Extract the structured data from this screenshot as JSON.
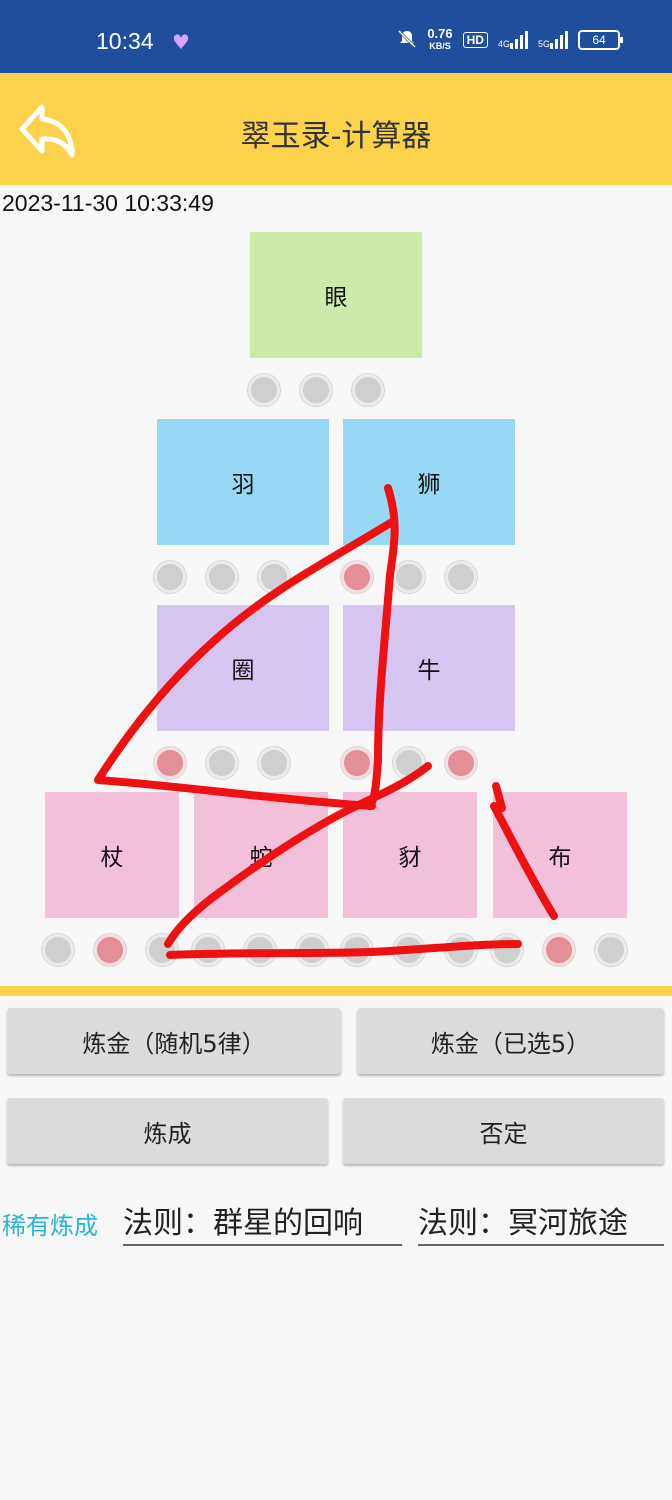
{
  "status": {
    "time": "10:34",
    "net_speed": "0.76",
    "net_unit": "KB/S",
    "hd": "HD",
    "signal1": "4G",
    "signal2": "5G",
    "battery": "64"
  },
  "appbar": {
    "title": "翠玉录-计算器",
    "back_icon": "back-arrow-icon"
  },
  "datetime": "2023-11-30 10:33:49",
  "tiles": {
    "top": "眼",
    "row2": [
      "羽",
      "狮"
    ],
    "row3": [
      "圈",
      "牛"
    ],
    "row4": [
      "杖",
      "蛇",
      "豺",
      "布"
    ]
  },
  "dots": {
    "row1": [
      false,
      false,
      false
    ],
    "row2": [
      false,
      false,
      false,
      true,
      false,
      false
    ],
    "row3": [
      true,
      false,
      false,
      true,
      false,
      true
    ],
    "row4": [
      false,
      true,
      false,
      false,
      false,
      false,
      false,
      false,
      false,
      false,
      true,
      false
    ]
  },
  "buttons": {
    "alchemy_random": "炼金（随机5律）",
    "alchemy_selected": "炼金（已选5）",
    "forge": "炼成",
    "deny": "否定"
  },
  "rare_label": "稀有炼成",
  "laws": [
    "法则：群星的回响",
    "法则：冥河旅途"
  ],
  "colors": {
    "status_bar": "#1f4f9c",
    "accent": "#fcd24c",
    "rare_text": "#2bb4d8",
    "scribble": "#ee1111"
  }
}
